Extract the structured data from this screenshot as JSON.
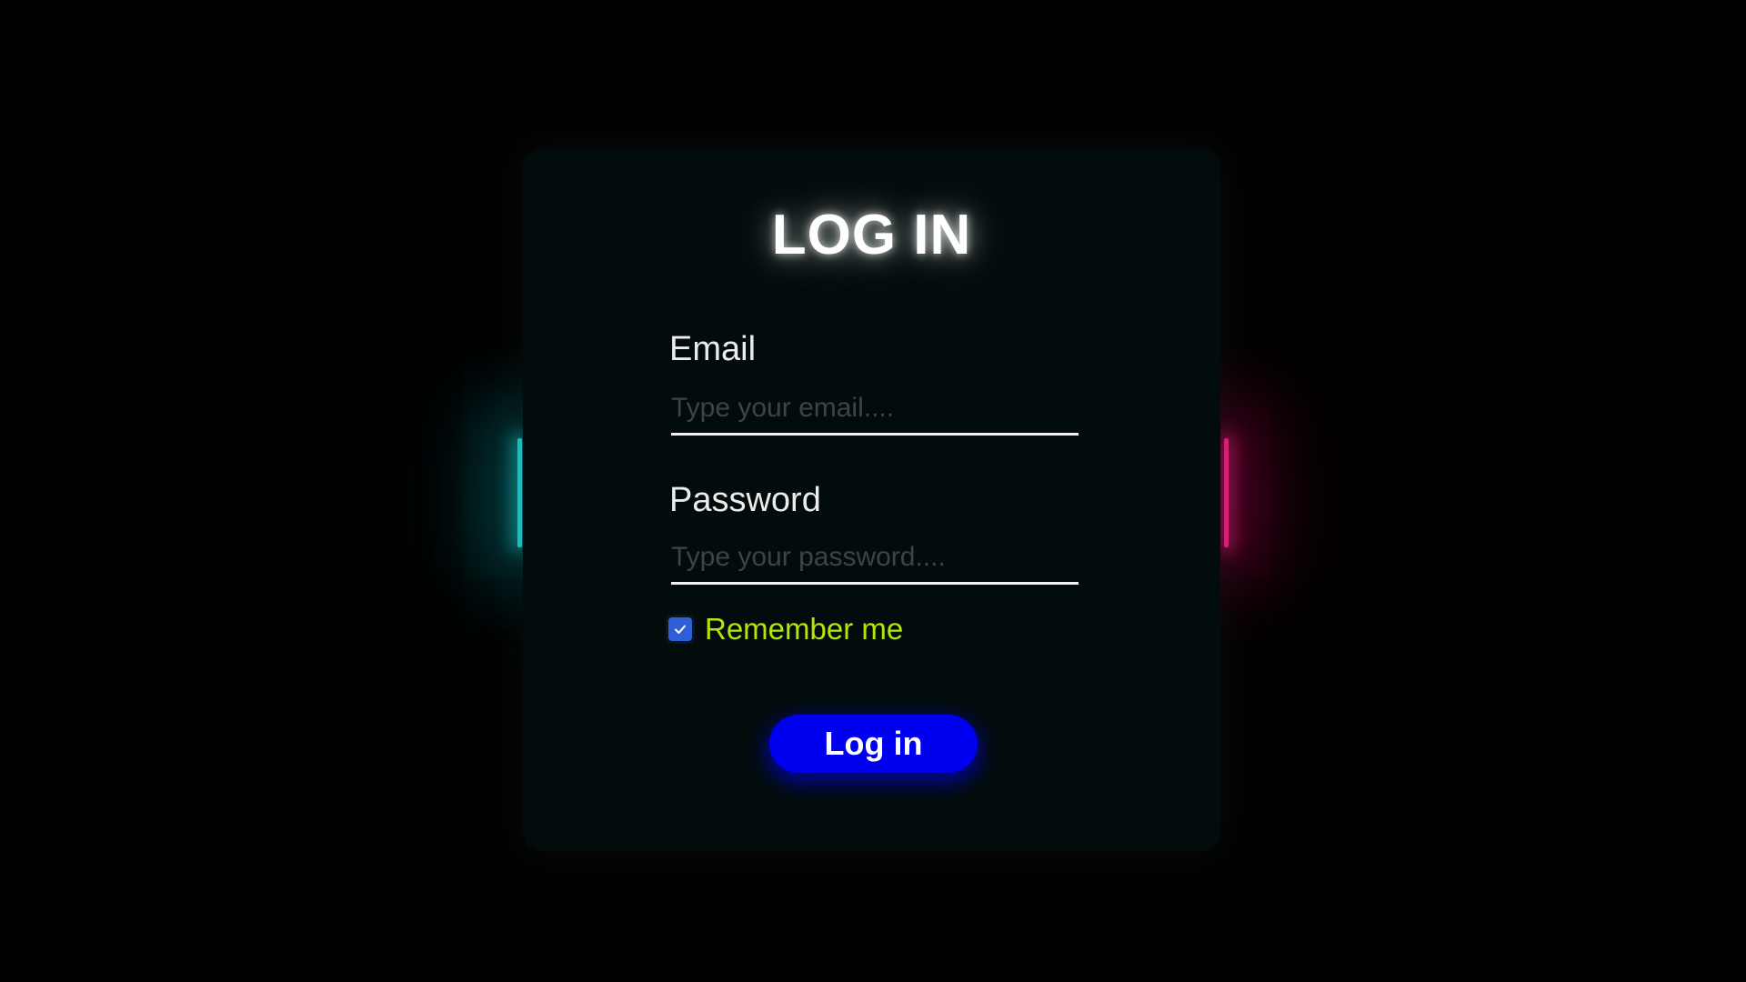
{
  "login": {
    "title": "LOG IN",
    "email": {
      "label": "Email",
      "placeholder": "Type your email....",
      "value": ""
    },
    "password": {
      "label": "Password",
      "placeholder": "Type your password....",
      "value": ""
    },
    "remember": {
      "label": "Remember me",
      "checked": true
    },
    "submit_label": "Log in"
  },
  "colors": {
    "background": "#000000",
    "card": "#030c0c",
    "accent_left": "#19e6e6",
    "accent_right": "#ff1f8a",
    "remember_text": "#b4e60a",
    "button": "#0000f0",
    "checkbox": "#2f5fd6"
  },
  "icons": {
    "checkbox": "checkmark-icon"
  }
}
